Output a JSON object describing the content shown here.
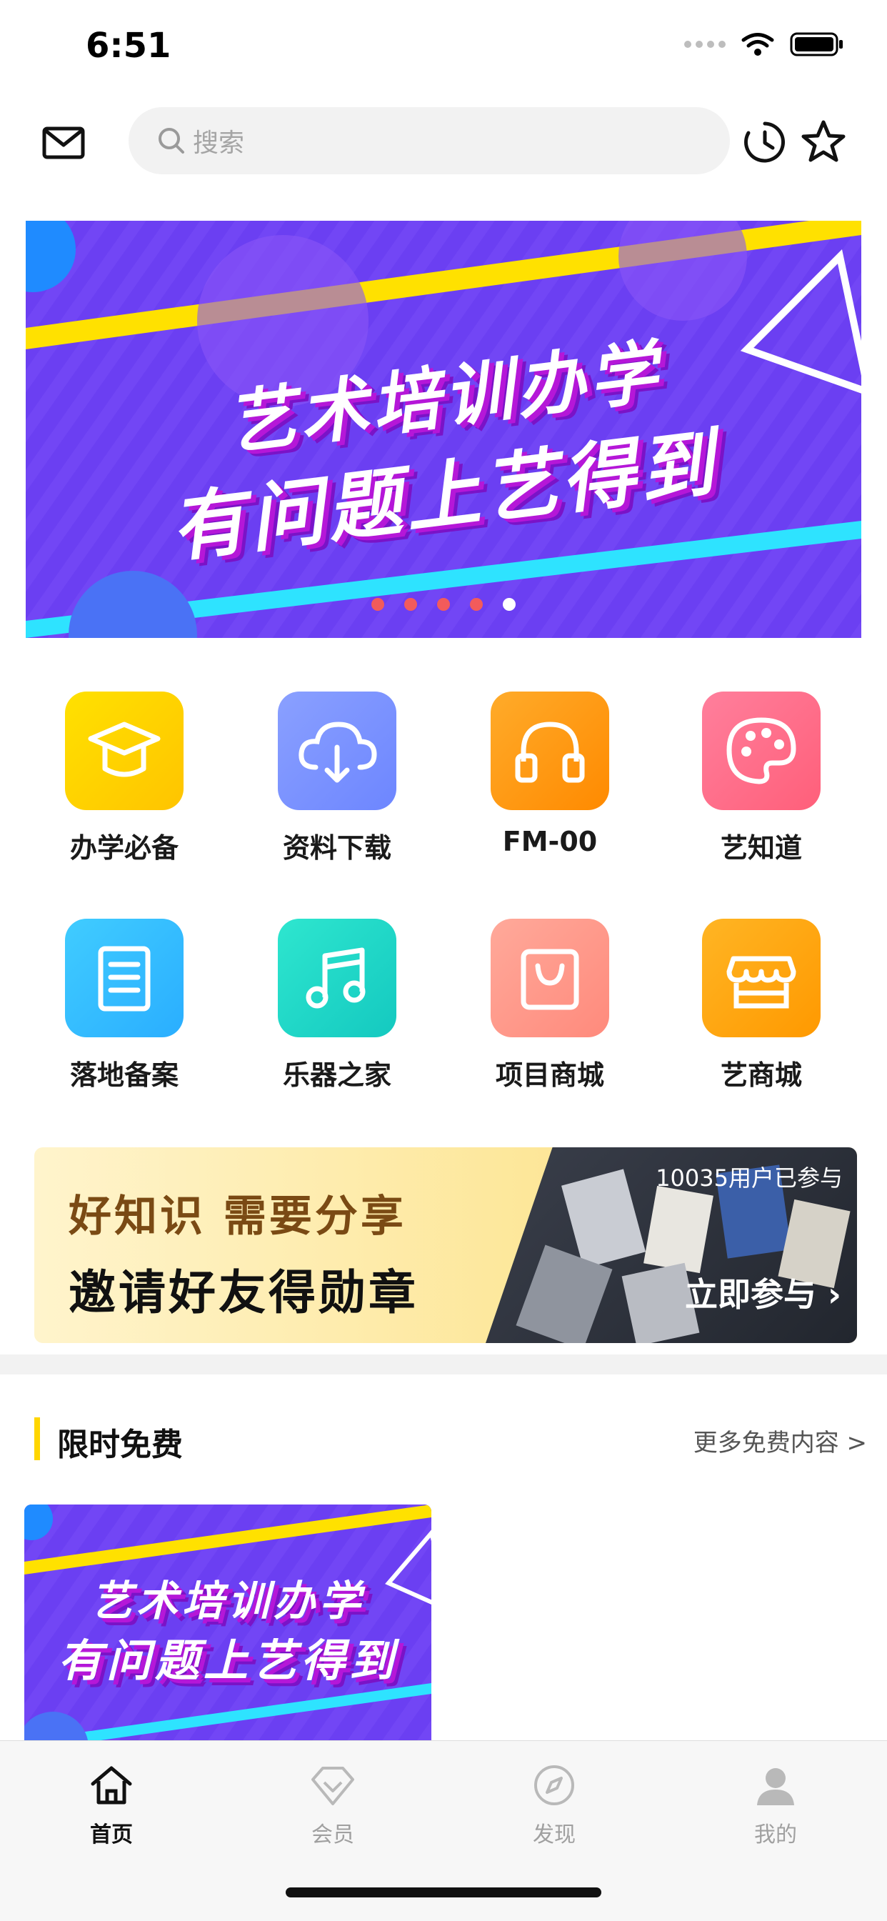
{
  "status": {
    "time": "6:51"
  },
  "search": {
    "placeholder": "搜索"
  },
  "banner": {
    "line1": "艺术培训办学",
    "line2": "有问题上艺得到",
    "dots_count": 5,
    "active_dot": 5
  },
  "grid": {
    "items": [
      {
        "label": "办学必备",
        "icon": "graduation-cap-icon",
        "color": "#ffd400"
      },
      {
        "label": "资料下载",
        "icon": "cloud-download-icon",
        "color": "#7d93ff"
      },
      {
        "label": "FM-00",
        "icon": "headphones-icon",
        "color": "#ff9f1a"
      },
      {
        "label": "艺知道",
        "icon": "palette-icon",
        "color": "#ff6b86"
      },
      {
        "label": "落地备案",
        "icon": "document-icon",
        "color": "#34c4ff"
      },
      {
        "label": "乐器之家",
        "icon": "music-note-icon",
        "color": "#1fd6c8"
      },
      {
        "label": "项目商城",
        "icon": "shopping-bag-icon",
        "color": "#ff9a8a"
      },
      {
        "label": "艺商城",
        "icon": "store-icon",
        "color": "#ffab1a"
      }
    ]
  },
  "promo": {
    "line1": "好知识 需要分享",
    "line2": "邀请好友得勋章",
    "count": "10035用户已参与",
    "join": "立即参与 ›"
  },
  "section": {
    "title": "限时免费",
    "more": "更多免费内容 >",
    "card_line1": "艺术培训办学",
    "card_line2": "有问题上艺得到"
  },
  "tabs": [
    {
      "label": "首页",
      "icon": "home-icon",
      "active": true
    },
    {
      "label": "会员",
      "icon": "diamond-icon",
      "active": false
    },
    {
      "label": "发现",
      "icon": "compass-icon",
      "active": false
    },
    {
      "label": "我的",
      "icon": "profile-icon",
      "active": false
    }
  ],
  "colors": {
    "accent": "#ffd600",
    "banner_purple": "#6a3df0"
  }
}
